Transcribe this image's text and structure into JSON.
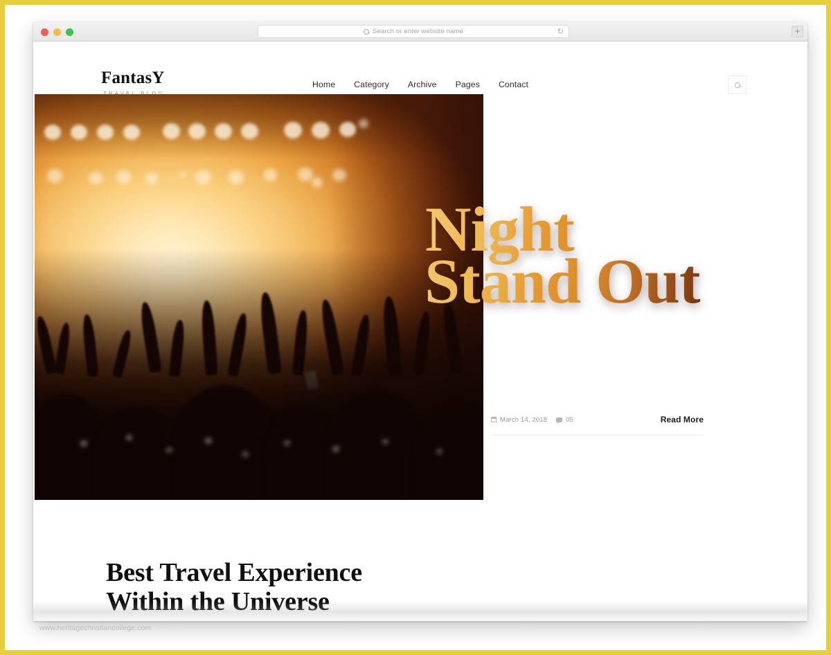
{
  "browser": {
    "traffic_lights": [
      "close",
      "minimize",
      "maximize"
    ],
    "address_placeholder": "Search or enter website name",
    "search_icon": "search-icon",
    "reload_icon": "reload-icon",
    "new_tab_label": "+"
  },
  "site": {
    "brand": {
      "title": "FantasY",
      "subtitle": "TRAVEL BLOG"
    },
    "nav": [
      {
        "label": "Home"
      },
      {
        "label": "Category"
      },
      {
        "label": "Archive"
      },
      {
        "label": "Pages"
      },
      {
        "label": "Contact"
      }
    ],
    "header_search_icon": "search-icon"
  },
  "hero": {
    "headline_line1": "Night",
    "headline_line2": "Stand Out",
    "meta": {
      "date_icon": "calendar-icon",
      "date": "March 14, 2018",
      "comments_icon": "comment-icon",
      "comments": "05"
    },
    "read_more": "Read More",
    "slides": [
      {
        "active": false
      },
      {
        "active": true
      },
      {
        "active": false
      }
    ]
  },
  "below": {
    "title_line1": "Best Travel Experience",
    "title_line2": "Within the Universe"
  },
  "watermark": "www.heritagechristiancollege.com",
  "colors": {
    "frame": "#e8cf3a",
    "headline_gold": "#e5992f",
    "headline_dark": "#2a1005",
    "text_dark": "#1b1b1b",
    "meta_gray": "#9a9a9a"
  }
}
